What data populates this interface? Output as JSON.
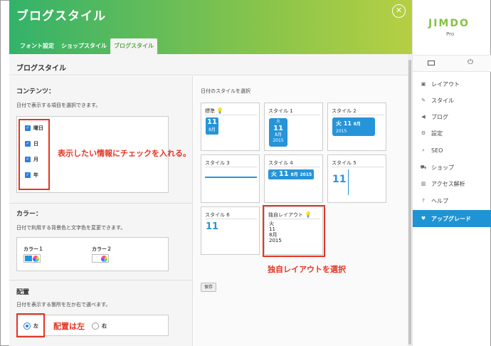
{
  "header": {
    "title": "ブログスタイル",
    "close_glyph": "✕",
    "tabs": [
      "フォント設定",
      "ショップスタイル",
      "ブログスタイル"
    ],
    "active_tab": 2
  },
  "section_title": "ブログスタイル",
  "contents": {
    "title": "コンテンツ：",
    "desc": "日付で表示する項目を選択できます。",
    "items": [
      {
        "label": "曜日",
        "checked": true
      },
      {
        "label": "日",
        "checked": true
      },
      {
        "label": "月",
        "checked": true
      },
      {
        "label": "年",
        "checked": true
      }
    ]
  },
  "color": {
    "title": "カラー：",
    "desc": "日付で利用する背景色と文字色を変更できます。",
    "color1_label": "カラー１",
    "color2_label": "カラー２",
    "color1_value": "#2694d9",
    "color2_value": "#ffffff"
  },
  "position": {
    "title": "配置",
    "desc": "日付を表示する箇所を左か右で選べます。",
    "options": [
      "左",
      "右"
    ],
    "selected": "左"
  },
  "annotations": {
    "contents_note": "表示したい情報にチェックを入れる。",
    "custom_note": "独自レイアウトを選択",
    "position_note": "配置は左"
  },
  "date_styles": {
    "title": "日付のスタイルを選択",
    "cards": [
      {
        "name": "標準",
        "bulb": "💡",
        "day": "11",
        "month": "8月"
      },
      {
        "name": "スタイル 1",
        "weekday": "火",
        "day": "11",
        "month": "8月",
        "year": "2015"
      },
      {
        "name": "スタイル 2",
        "weekday": "火",
        "day": "11",
        "month": "8月",
        "year": "2015"
      },
      {
        "name": "スタイル 3"
      },
      {
        "name": "スタイル 4",
        "weekday": "火",
        "day": "11",
        "month": "8月",
        "year": "2015"
      },
      {
        "name": "スタイル 5",
        "day": "11"
      },
      {
        "name": "スタイル 6",
        "day": "11"
      },
      {
        "name": "独自レイアウト",
        "bulb": "💡",
        "weekday": "火",
        "day": "11",
        "month": "8月",
        "year": "2015"
      }
    ],
    "save_label": "保存"
  },
  "sidebar": {
    "logo": "JIMDO",
    "plan": "Pro",
    "items": [
      {
        "label": "レイアウト",
        "icon": "layout-icon",
        "glyph": "▣"
      },
      {
        "label": "スタイル",
        "icon": "brush-icon",
        "glyph": "✎"
      },
      {
        "label": "ブログ",
        "icon": "megaphone-icon",
        "glyph": "◀"
      },
      {
        "label": "設定",
        "icon": "gear-icon",
        "glyph": "⚙"
      },
      {
        "label": "SEO",
        "icon": "search-icon",
        "glyph": "⌕"
      },
      {
        "label": "ショップ",
        "icon": "cart-icon",
        "glyph": "⛟"
      },
      {
        "label": "アクセス解析",
        "icon": "chart-icon",
        "glyph": "▥"
      },
      {
        "label": "ヘルプ",
        "icon": "help-icon",
        "glyph": "?"
      },
      {
        "label": "アップグレード",
        "icon": "heart-icon",
        "glyph": "♥"
      }
    ]
  },
  "colors": {
    "accent": "#1f94d4",
    "annotation": "#e53423",
    "checkbox": "#2f7fd8",
    "date_blue": "#2694d9",
    "brand_green": "#82c340"
  }
}
